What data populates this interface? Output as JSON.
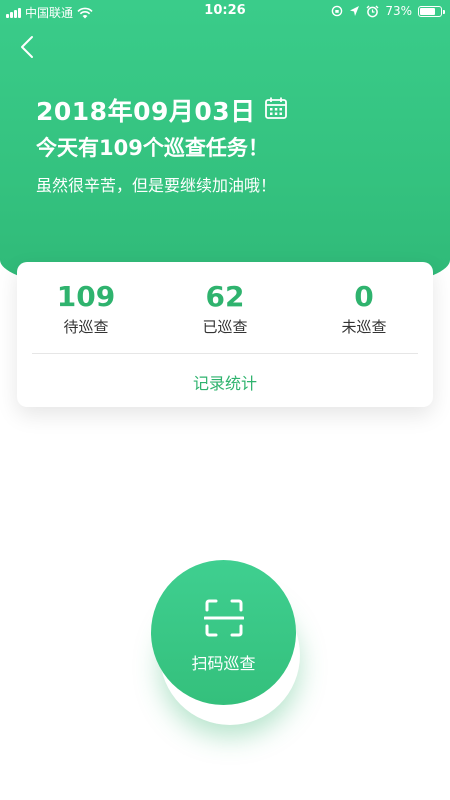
{
  "status_bar": {
    "carrier": "中国联通",
    "time": "10:26",
    "battery": "73%",
    "battery_level": 0.73
  },
  "header": {
    "date": "2018年09月03日",
    "tasks": "今天有109个巡查任务！",
    "cheer": "虽然很辛苦，但是要继续加油哦！"
  },
  "stats": {
    "items": [
      {
        "value": "109",
        "label": "待巡查"
      },
      {
        "value": "62",
        "label": "已巡查"
      },
      {
        "value": "0",
        "label": "未巡查"
      }
    ],
    "records_link": "记录统计"
  },
  "scan": {
    "label": "扫码巡查"
  },
  "colors": {
    "accent": "#2fb36e",
    "header": "#3acc8a"
  }
}
